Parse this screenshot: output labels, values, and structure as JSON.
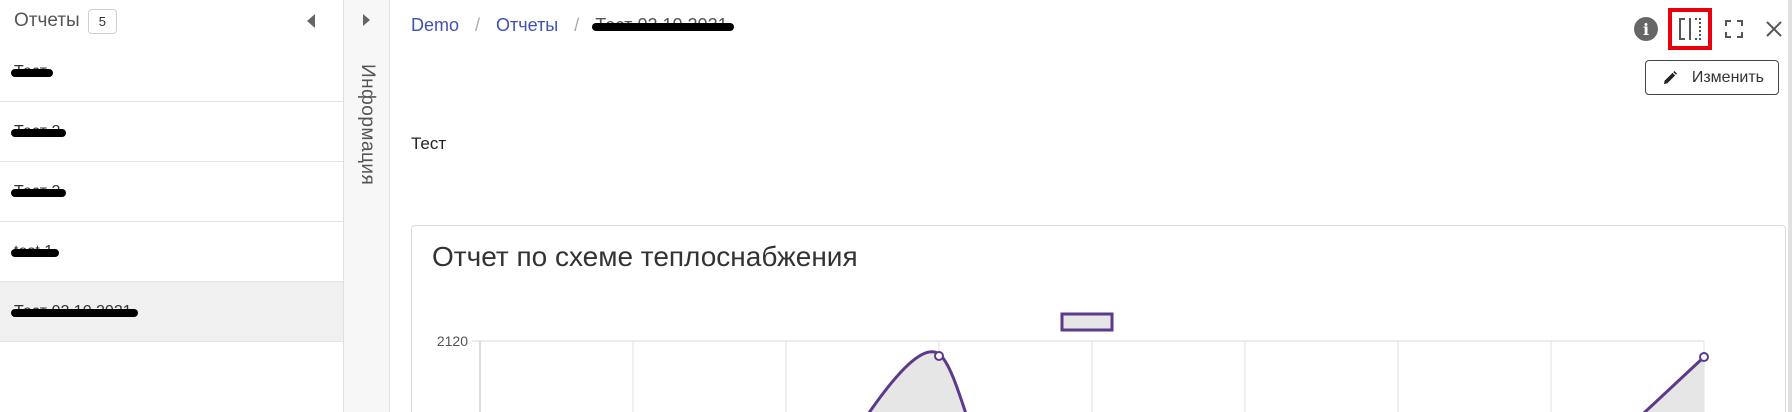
{
  "list": {
    "title": "Отчеты",
    "count": "5",
    "items": [
      {
        "label": "Тест",
        "selected": false
      },
      {
        "label": "Тест 2",
        "selected": false
      },
      {
        "label": "Тест 3",
        "selected": false
      },
      {
        "label": "test 1",
        "selected": false
      },
      {
        "label": "Тест 02.10.2021",
        "selected": true
      }
    ]
  },
  "info_panel": {
    "label": "Информация"
  },
  "breadcrumb": {
    "items": [
      "Demo",
      "Отчеты"
    ],
    "current": "Тест 02.10.2021",
    "separator": "/"
  },
  "toolbar": {
    "icons": [
      "info-icon",
      "split-view-icon",
      "fullscreen-icon",
      "close-icon"
    ],
    "highlight_color": "#e8000d"
  },
  "edit_button": {
    "label": "Изменить"
  },
  "description": "Тест",
  "chart_data": {
    "type": "line",
    "title": "Отчет по схеме теплоснабжения",
    "yticks": [
      "2120"
    ],
    "series": [
      {
        "color": "#5b3a8c",
        "fill": "#e6e6e6"
      }
    ]
  },
  "colors": {
    "link": "#3f51b5",
    "series": "#5b3a8c",
    "highlight": "#e8000d"
  }
}
